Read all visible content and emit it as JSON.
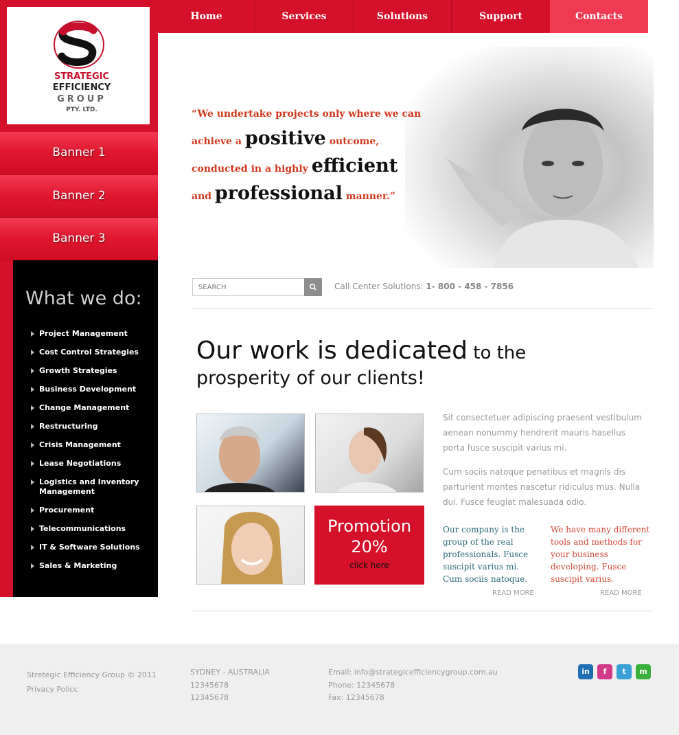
{
  "logo": {
    "line1": "STRATEGIC",
    "line2": "EFFICIENCY",
    "line3": "GROUP",
    "line4": "PTY. LTD."
  },
  "nav": {
    "items": [
      "Home",
      "Services",
      "Solutions",
      "Support",
      "Contacts"
    ],
    "active": "Contacts"
  },
  "banners": [
    "Banner 1",
    "Banner 2",
    "Banner 3"
  ],
  "what_we_do": {
    "title": "What we do:",
    "items": [
      "Project Management",
      "Cost Control Strategies",
      "Growth Strategies",
      "Business Development",
      "Change Management",
      "Restructuring",
      "Crisis Management",
      "Lease Negotiations",
      "Logistics and Inventory Management",
      "Procurement",
      "Telecommunications",
      "IT & Software Solutions",
      "Sales & Marketing"
    ]
  },
  "hero": {
    "q1": "“We undertake projects only where we can",
    "q2a": "achieve a ",
    "q2b": "positive",
    "q2c": " outcome,",
    "q3a": "conducted in a highly ",
    "q3b": "efficient",
    "q4a": "and ",
    "q4b": "professional",
    "q4c": " manner.”"
  },
  "search": {
    "placeholder": "SEARCH",
    "call_label": "Call Center Solutions: ",
    "call_number": "1- 800 - 458 - 7856"
  },
  "headline": {
    "part1": "Our work is dedicated",
    "part2": " to the",
    "line2": "prosperity of our clients!"
  },
  "promo": {
    "title": "Promotion",
    "percent": "20%",
    "link": "click here"
  },
  "paragraphs": {
    "p1": "Sit consectetuer adipiscing praesent vestibulum aenean nonummy hendrerit mauris hasellus porta fusce suscipit varius mi.",
    "p2": "Cum sociis natoque penatibus et magnis dis parturient montes nascetur ridiculus mus. Nulla dui. Fusce feugiat malesuada odio."
  },
  "columns": {
    "col_a": "Our company is the group of the real professionals. Fusce suscipit varius mi. Cum sociis natoque.",
    "col_b": "We have many different tools and methods for your business developing. Fusce suscipit varius.",
    "read_more": "READ MORE"
  },
  "footer": {
    "copyright": "Stretegic Efficiency Group © 2011",
    "privacy": "Privacy Policc",
    "city": "SYDNEY - AUSTRALIA",
    "phone1": "12345678",
    "phone2": "12345678",
    "email": "Email: info@strategicefficiencygroup.com.au",
    "phone": "Phone: 12345678",
    "fax": "Fax: 12345678",
    "socials": [
      "in",
      "f",
      "t",
      "m"
    ]
  },
  "colors": {
    "brand_red": "#d5102a",
    "active_nav": "#ef3a52",
    "quote_orange": "#d03a1e",
    "teal_text": "#2d6b7a"
  }
}
